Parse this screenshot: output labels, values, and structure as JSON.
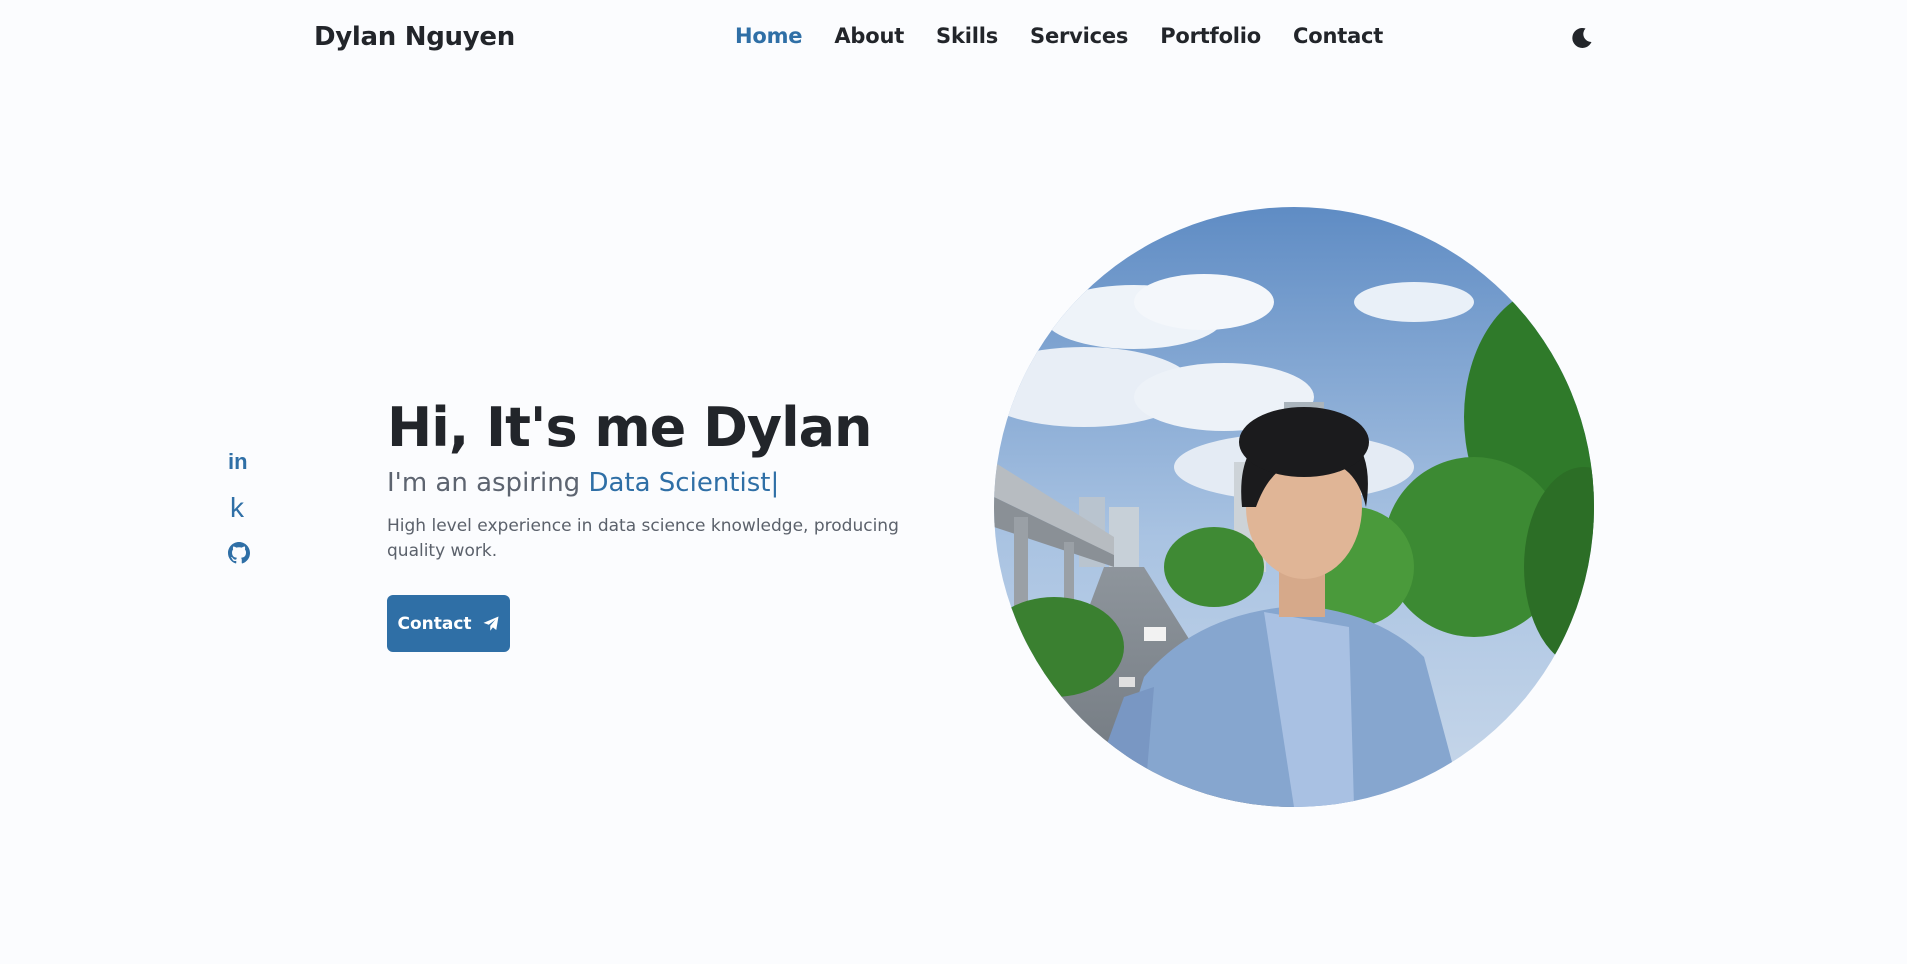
{
  "header": {
    "logo": "Dylan Nguyen",
    "nav": [
      {
        "label": "Home",
        "active": true
      },
      {
        "label": "About",
        "active": false
      },
      {
        "label": "Skills",
        "active": false
      },
      {
        "label": "Services",
        "active": false
      },
      {
        "label": "Portfolio",
        "active": false
      },
      {
        "label": "Contact",
        "active": false
      }
    ],
    "theme_icon": "moon-icon"
  },
  "social": [
    {
      "icon": "linkedin-icon",
      "glyph": "in"
    },
    {
      "icon": "kaggle-icon",
      "glyph": "k"
    },
    {
      "icon": "github-icon"
    }
  ],
  "hero": {
    "title": "Hi, It's me Dylan",
    "subtitle_prefix": "I'm an aspiring ",
    "role": "Data Scientist",
    "caret": "|",
    "description": "High level experience in data science knowledge, producing quality work.",
    "cta_label": "Contact",
    "cta_icon": "send-icon"
  },
  "colors": {
    "accent": "#2f6fa6",
    "text": "#22252a",
    "muted": "#5d6470",
    "background": "#fbfcfe"
  }
}
